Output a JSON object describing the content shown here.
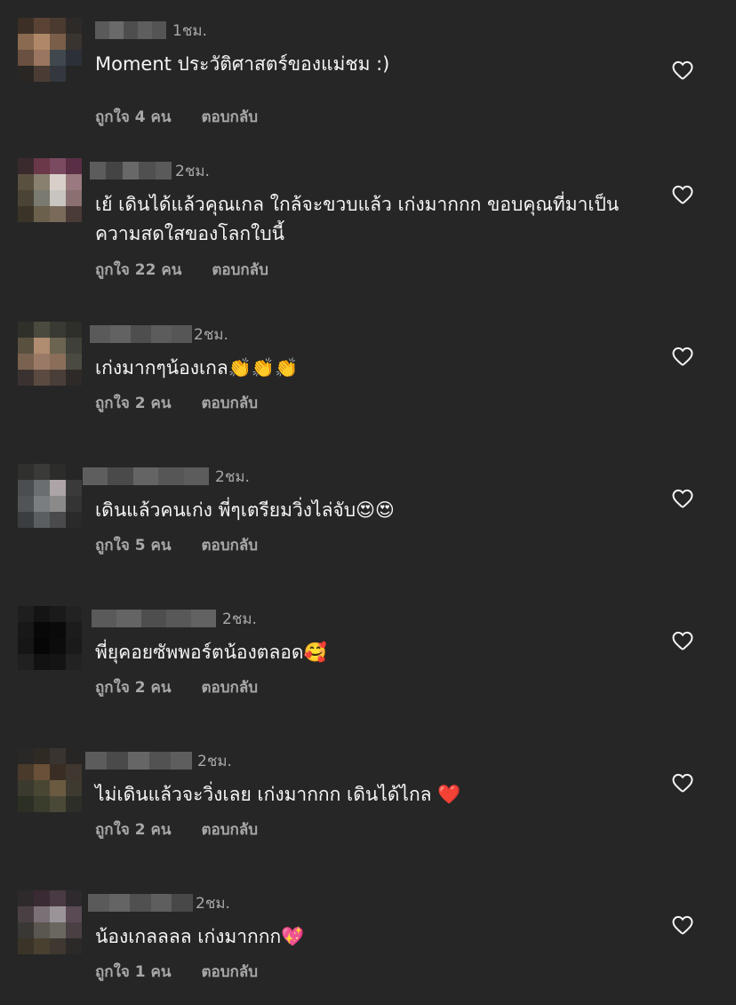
{
  "comments": [
    {
      "time": "1ชม.",
      "text": "Moment ประวัติศาสตร์ของแม่ชม :)",
      "likes": "ถูกใจ 4 คน",
      "reply": "ตอบกลับ",
      "avatar_colors": [
        "#3c3026",
        "#5a4335",
        "#4a3a30",
        "#2e2a28",
        "#8a6a50",
        "#b08868",
        "#7a5e4a",
        "#3a3430",
        "#6a5040",
        "#9a7660",
        "#40484e",
        "#2c3038",
        "#2a2624",
        "#4a3c34",
        "#34383e",
        "#262626"
      ],
      "name_colors": [
        "#5a5a5a",
        "#6a6a6a",
        "#4e4e4e",
        "#5e5e5e",
        "#545454"
      ]
    },
    {
      "time": "2ชม.",
      "text": "เย้ เดินได้แล้วคุณเกล ใกล้จะขวบแล้ว เก่งมากกก ขอบคุณที่มาเป็นความสดใสของโลกใบนี้",
      "likes": "ถูกใจ 22 คน",
      "reply": "ตอบกลับ",
      "avatar_colors": [
        "#3a2a2e",
        "#6a3848",
        "#7a4a60",
        "#5a2e44",
        "#5a5040",
        "#8a8070",
        "#d8d0c8",
        "#9a7a80",
        "#4a4436",
        "#7a7a70",
        "#c8c4c0",
        "#8a7070",
        "#3a3428",
        "#6a604c",
        "#7a6a5a",
        "#4a3a38"
      ],
      "name_colors": [
        "#5c5c5c",
        "#444444",
        "#686868",
        "#505050",
        "#5a5a5a"
      ]
    },
    {
      "time": "2ชม.",
      "text": "เก่งมากๆน้องเกล👏👏👏",
      "likes": "ถูกใจ 2 คน",
      "reply": "ตอบกลับ",
      "avatar_colors": [
        "#30302a",
        "#4a4a3e",
        "#3a3a34",
        "#2e2e2a",
        "#5a5040",
        "#b08c70",
        "#6a6450",
        "#40403a",
        "#7a6250",
        "#9a7a66",
        "#8a6e5a",
        "#4a4a40",
        "#3a3230",
        "#5a4a40",
        "#4a3e38",
        "#2e2a28"
      ],
      "name_colors": [
        "#5a5a5a",
        "#626262",
        "#4e4e4e",
        "#5c5c5c",
        "#565656"
      ]
    },
    {
      "time": "2ชม.",
      "text": "เดินแล้วคนเก่ง พี่ๆเตรียมวิ่งไล่จับ😍😍",
      "likes": "ถูกใจ 5 คน",
      "reply": "ตอบกลับ",
      "avatar_colors": [
        "#30302e",
        "#3a3a38",
        "#2c2c2a",
        "#262626",
        "#4a4e50",
        "#6a6e70",
        "#aca4a6",
        "#3a3a3a",
        "#505456",
        "#7a7e80",
        "#8a8a8a",
        "#343434",
        "#3a3e40",
        "#5a5e60",
        "#4a4a4c",
        "#2a2a2a"
      ],
      "name_colors": [
        "#5e5e5e",
        "#4a4a4a",
        "#646464",
        "#565656",
        "#5c5c5c"
      ]
    },
    {
      "time": "2ชม.",
      "text": "พี่ยุคอยซัพพอร์ตน้องตลอด🥰",
      "likes": "ถูกใจ 2 คน",
      "reply": "ตอบกลับ",
      "avatar_colors": [
        "#1e1e1e",
        "#141414",
        "#1a1a1a",
        "#222222",
        "#181818",
        "#080808",
        "#0a0a0a",
        "#1c1c1c",
        "#161616",
        "#060606",
        "#0c0c0c",
        "#1a1a1a",
        "#202020",
        "#121212",
        "#141414",
        "#222222"
      ],
      "name_colors": [
        "#5a5a5a",
        "#646464",
        "#4e4e4e",
        "#585858",
        "#626262"
      ]
    },
    {
      "time": "2ชม.",
      "text": "ไม่เดินแล้วจะวิ่งเลย เก่งมากกก เดินได้ไกล ❤️",
      "likes": "ถูกใจ 2 คน",
      "reply": "ตอบกลับ",
      "avatar_colors": [
        "#2a2826",
        "#302a24",
        "#3a3430",
        "#282624",
        "#4a3a2c",
        "#6a5038",
        "#3a2e24",
        "#403830",
        "#3a3a2e",
        "#4a4634",
        "#6a5a40",
        "#3e3a30",
        "#2c3024",
        "#3a3c2c",
        "#4a4836",
        "#2e2e28"
      ],
      "name_colors": [
        "#5c5c5c",
        "#4a4a4a",
        "#666666",
        "#525252",
        "#5e5e5e"
      ]
    },
    {
      "time": "2ชม.",
      "text": "น้องเกลลลล เก่งมากกก💖",
      "likes": "ถูกใจ 1 คน",
      "reply": "ตอบกลับ",
      "avatar_colors": [
        "#2e2a2c",
        "#3a2a34",
        "#4a3a44",
        "#2e2a2e",
        "#4a4044",
        "#7a7076",
        "#9a9498",
        "#5a4a54",
        "#3a3834",
        "#5a5650",
        "#6a6660",
        "#4a4044",
        "#3a3428",
        "#4a4030",
        "#3e3830",
        "#2c2a28"
      ],
      "name_colors": [
        "#5a5a5a",
        "#646464",
        "#505050",
        "#5e5e5e",
        "#484848"
      ]
    }
  ]
}
